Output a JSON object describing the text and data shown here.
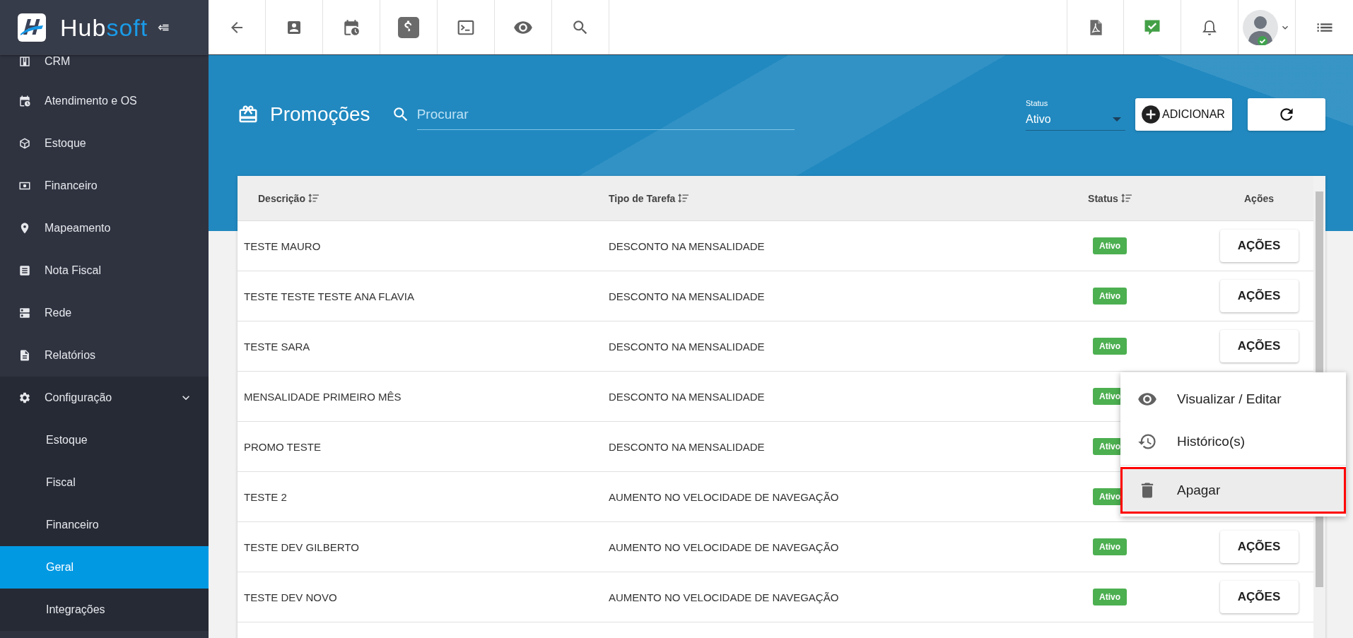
{
  "brand": {
    "part_1": "Hub",
    "part_2": "soft"
  },
  "sidebar": {
    "items": [
      {
        "label": "CRM",
        "expanded": false
      },
      {
        "label": "Atendimento e OS",
        "expanded": false
      },
      {
        "label": "Estoque",
        "expanded": false
      },
      {
        "label": "Financeiro",
        "expanded": false
      },
      {
        "label": "Mapeamento",
        "expanded": false
      },
      {
        "label": "Nota Fiscal",
        "expanded": false
      },
      {
        "label": "Rede",
        "expanded": false
      },
      {
        "label": "Relatórios",
        "expanded": false
      },
      {
        "label": "Configuração",
        "expanded": true,
        "children": [
          {
            "label": "Estoque",
            "selected": false
          },
          {
            "label": "Fiscal",
            "selected": false
          },
          {
            "label": "Financeiro",
            "selected": false
          },
          {
            "label": "Geral",
            "selected": true
          },
          {
            "label": "Integrações",
            "selected": false
          }
        ]
      }
    ]
  },
  "page": {
    "title": "Promoções",
    "search": {
      "placeholder": "Procurar"
    },
    "status_filter": {
      "label": "Status",
      "value": "Ativo"
    },
    "add_button": "ADICIONAR"
  },
  "table": {
    "columns": [
      {
        "label": "Descrição",
        "sortable": true
      },
      {
        "label": "Tipo de Tarefa",
        "sortable": true
      },
      {
        "label": "Status",
        "sortable": true
      },
      {
        "label": "Ações",
        "sortable": false
      }
    ],
    "rows": [
      {
        "description": "TESTE MAURO",
        "task_type": "DESCONTO NA MENSALIDADE",
        "status": "Ativo",
        "action": "AÇÕES"
      },
      {
        "description": "TESTE TESTE TESTE ANA FLAVIA",
        "task_type": "DESCONTO NA MENSALIDADE",
        "status": "Ativo",
        "action": "AÇÕES"
      },
      {
        "description": "TESTE SARA",
        "task_type": "DESCONTO NA MENSALIDADE",
        "status": "Ativo",
        "action": "AÇÕES"
      },
      {
        "description": "MENSALIDADE PRIMEIRO MÊS",
        "task_type": "DESCONTO NA MENSALIDADE",
        "status": "Ativo"
      },
      {
        "description": "PROMO TESTE",
        "task_type": "DESCONTO NA MENSALIDADE",
        "status": "Ativo"
      },
      {
        "description": "TESTE 2",
        "task_type": "AUMENTO NO VELOCIDADE DE NAVEGAÇÃO",
        "status": "Ativo"
      },
      {
        "description": "TESTE DEV GILBERTO",
        "task_type": "AUMENTO NO VELOCIDADE DE NAVEGAÇÃO",
        "status": "Ativo",
        "action": "AÇÕES"
      },
      {
        "description": "TESTE DEV NOVO",
        "task_type": "AUMENTO NO VELOCIDADE DE NAVEGAÇÃO",
        "status": "Ativo",
        "action": "AÇÕES"
      }
    ]
  },
  "context_menu": {
    "items": [
      {
        "kind": "view",
        "label": "Visualizar / Editar",
        "selected": false
      },
      {
        "kind": "history",
        "label": "Histórico(s)",
        "selected": false
      },
      {
        "kind": "delete",
        "label": "Apagar",
        "selected": true
      }
    ]
  }
}
